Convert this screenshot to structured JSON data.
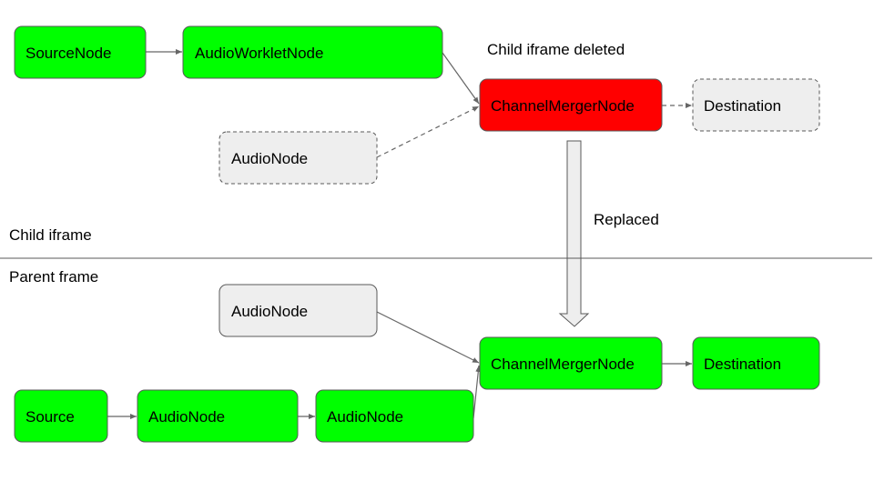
{
  "colors": {
    "active": "#00ff00",
    "deleted": "#ff0000",
    "inactive": "#eeeeee",
    "border": "#595959"
  },
  "labels": {
    "deleted_note": "Child iframe deleted",
    "replaced": "Replaced",
    "child_iframe": "Child iframe",
    "parent_frame": "Parent frame"
  },
  "child": {
    "source": "SourceNode",
    "worklet": "AudioWorkletNode",
    "merger": "ChannelMergerNode",
    "destination": "Destination",
    "audio_node": "AudioNode"
  },
  "parent": {
    "audio_node_top": "AudioNode",
    "merger": "ChannelMergerNode",
    "destination": "Destination",
    "source": "Source",
    "audio_node_1": "AudioNode",
    "audio_node_2": "AudioNode"
  }
}
